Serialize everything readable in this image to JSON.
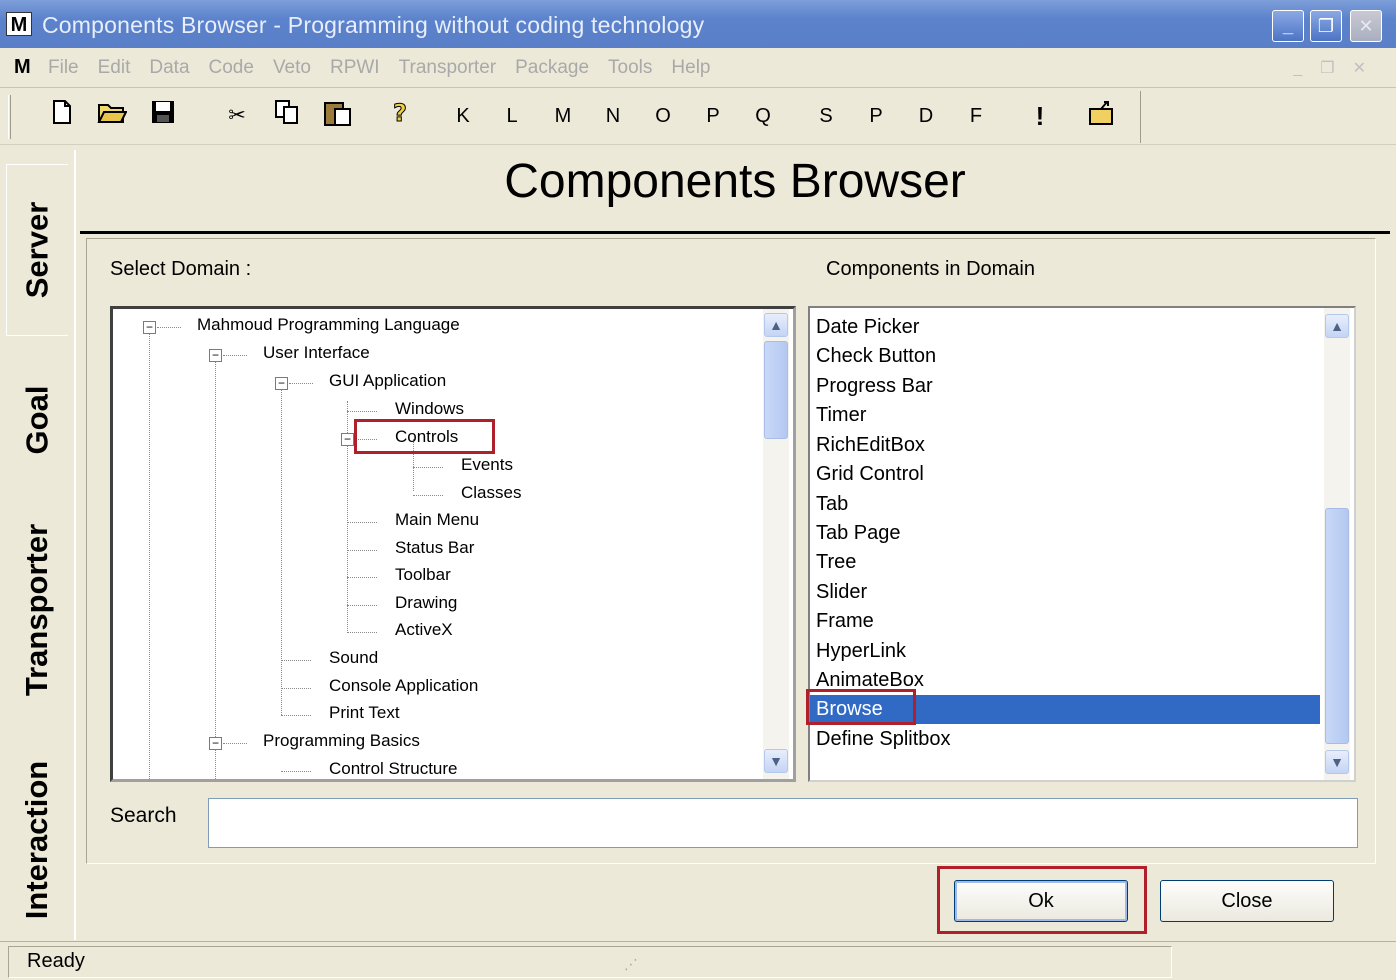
{
  "window": {
    "title": "Components Browser - Programming without coding technology",
    "app_icon": "M"
  },
  "menu": {
    "logo": "M",
    "items": [
      "File",
      "Edit",
      "Data",
      "Code",
      "Veto",
      "RPWI",
      "Transporter",
      "Package",
      "Tools",
      "Help"
    ]
  },
  "toolbar": {
    "letters": [
      "K",
      "L",
      "M",
      "N",
      "O",
      "P",
      "Q",
      "S",
      "P",
      "D",
      "F",
      "!"
    ]
  },
  "sidetabs": [
    "Server",
    "Goal",
    "Transporter",
    "Interaction"
  ],
  "page": {
    "heading": "Components Browser",
    "select_domain_label": "Select Domain :",
    "components_label": "Components in Domain",
    "search_label": "Search",
    "search_value": "",
    "ok_label": "Ok",
    "close_label": "Close"
  },
  "tree": [
    "Mahmoud Programming Language",
    "User Interface",
    "GUI Application",
    "Windows",
    "Controls",
    "Events",
    "Classes",
    "Main Menu",
    "Status Bar",
    "Toolbar",
    "Drawing",
    "ActiveX",
    "Sound",
    "Console Application",
    "Print Text",
    "Programming Basics",
    "Control Structure"
  ],
  "components": [
    "Date Picker",
    "Check Button",
    "Progress Bar",
    "Timer",
    "RichEditBox",
    "Grid Control",
    "Tab",
    "Tab Page",
    "Tree",
    "Slider",
    "Frame",
    "HyperLink",
    "AnimateBox",
    "Browse",
    "Define Splitbox"
  ],
  "selected_component": "Browse",
  "selected_tree_node": "Controls",
  "status": {
    "text": "Ready"
  },
  "colors": {
    "selection": "#316ac5",
    "highlight_box": "#b0202a",
    "titlebar": "#5a7fc8"
  }
}
